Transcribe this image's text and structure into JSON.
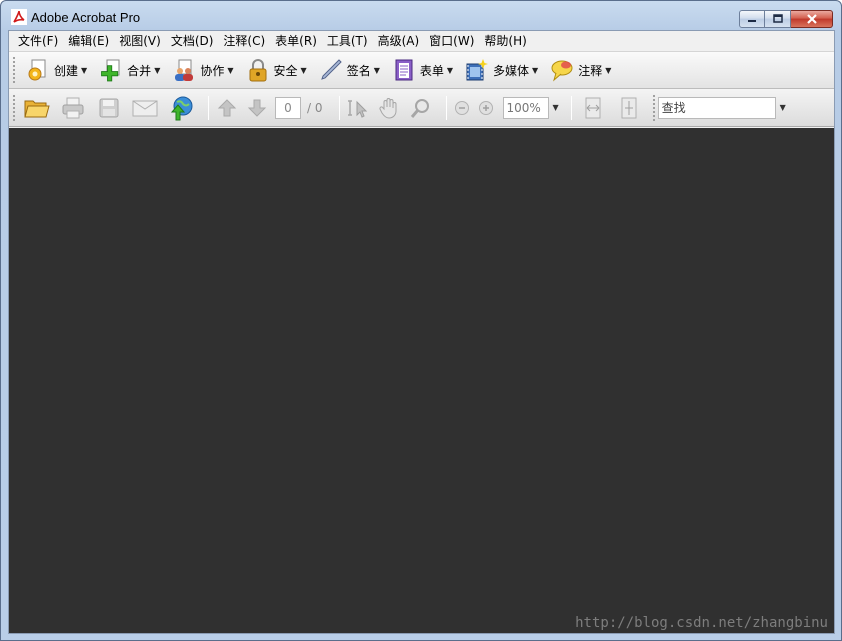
{
  "window": {
    "title": "Adobe Acrobat Pro"
  },
  "menubar": [
    "文件(F)",
    "编辑(E)",
    "视图(V)",
    "文档(D)",
    "注释(C)",
    "表单(R)",
    "工具(T)",
    "高级(A)",
    "窗口(W)",
    "帮助(H)"
  ],
  "toolbar1": [
    {
      "label": "创建",
      "icon": "create-icon"
    },
    {
      "label": "合并",
      "icon": "combine-icon"
    },
    {
      "label": "协作",
      "icon": "collaborate-icon"
    },
    {
      "label": "安全",
      "icon": "lock-icon"
    },
    {
      "label": "签名",
      "icon": "pen-icon"
    },
    {
      "label": "表单",
      "icon": "form-icon"
    },
    {
      "label": "多媒体",
      "icon": "multimedia-icon"
    },
    {
      "label": "注释",
      "icon": "comment-icon"
    }
  ],
  "toolbar2": {
    "page_number": "0",
    "page_total": "/ 0",
    "zoom": "100%",
    "search_placeholder": "查找"
  },
  "watermark": "http://blog.csdn.net/zhangbinu",
  "colors": {
    "document_bg": "#303030",
    "titlebar": "#c3d6ee",
    "close_button": "#c8463a"
  }
}
